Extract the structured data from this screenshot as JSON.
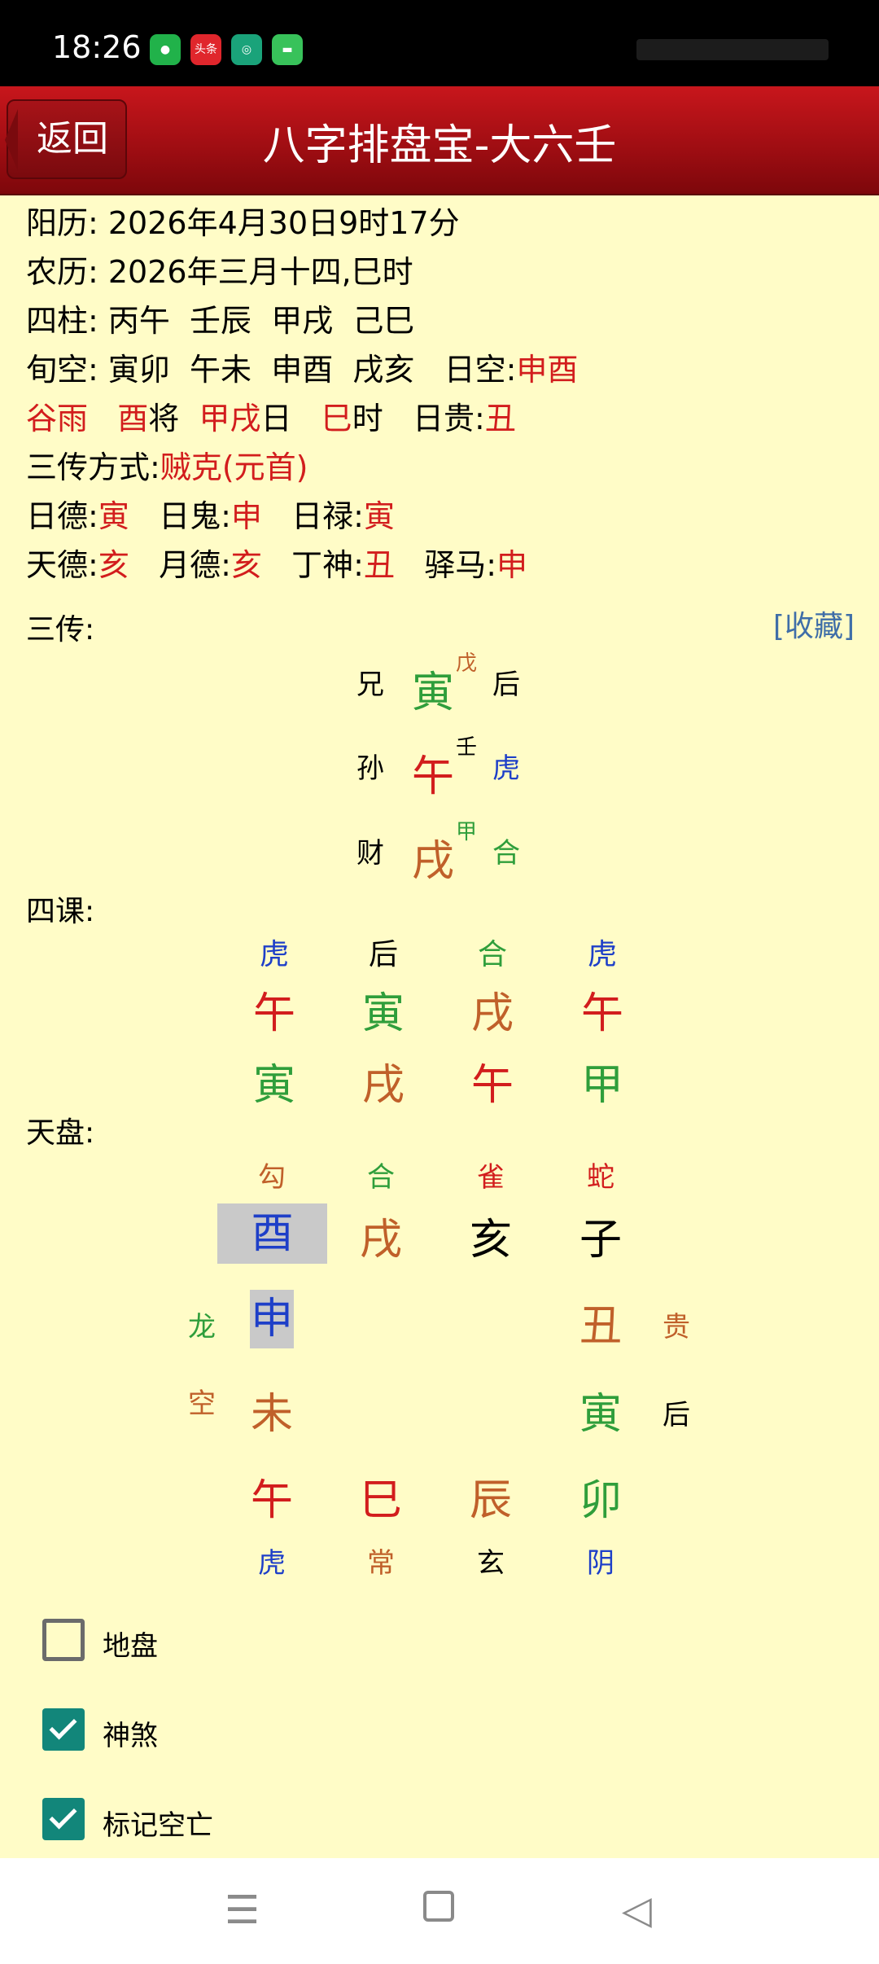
{
  "status": {
    "time": "18:26",
    "app2_label": "头条"
  },
  "header": {
    "back_label": "返回",
    "title": "八字排盘宝-大六壬"
  },
  "info": {
    "solar": "阳历: 2026年4月30日9时17分",
    "lunar": "农历: 2026年三月十四,巳时",
    "pillars": "四柱: 丙午  壬辰  甲戌  己巳",
    "xunkong_prefix": "旬空: 寅卯  午未  申酉  戌亥   日空:",
    "rikong": "申酉",
    "term": "谷雨",
    "jiang_branch": "酉",
    "jiang_label": "将",
    "day_gz": "甲戌",
    "day_label": "日",
    "hour_branch": "巳",
    "hour_label": "时",
    "rigui_label": "日贵:",
    "rigui": "丑",
    "method_label": "三传方式:",
    "method": "贼克(元首)",
    "ride_label": "日德:",
    "ride": "寅",
    "rigui2_label": "日鬼:",
    "rigui2": "申",
    "rilu_label": "日禄:",
    "rilu": "寅",
    "tiande_label": "天德:",
    "tiande": "亥",
    "yuede_label": "月德:",
    "yuede": "亥",
    "dingshen_label": "丁神:",
    "dingshen": "丑",
    "yima_label": "驿马:",
    "yima": "申"
  },
  "sanchuan": {
    "label": "三传:",
    "favorite": "[收藏]",
    "rows": [
      {
        "relation": "兄",
        "branch": "寅",
        "stem": "戊",
        "general": "后"
      },
      {
        "relation": "孙",
        "branch": "午",
        "stem": "壬",
        "general": "虎"
      },
      {
        "relation": "财",
        "branch": "戌",
        "stem": "甲",
        "general": "合"
      }
    ]
  },
  "sike": {
    "label": "四课:",
    "generals": [
      "虎",
      "后",
      "合",
      "虎"
    ],
    "upper": [
      "午",
      "寅",
      "戌",
      "午"
    ],
    "lower": [
      "寅",
      "戌",
      "午",
      "甲"
    ]
  },
  "tianpan": {
    "label": "天盘:",
    "top_generals": [
      "勾",
      "合",
      "雀",
      "蛇"
    ],
    "top_branches": [
      "酉",
      "戌",
      "亥",
      "子"
    ],
    "left_labels": [
      "龙",
      "空"
    ],
    "left_branches": [
      "申",
      "未"
    ],
    "right_branches": [
      "丑",
      "寅"
    ],
    "right_generals": [
      "贵",
      "后"
    ],
    "bottom_branches": [
      "午",
      "巳",
      "辰",
      "卯"
    ],
    "bottom_generals": [
      "虎",
      "常",
      "玄",
      "阴"
    ]
  },
  "options": [
    {
      "label": "地盘",
      "checked": false
    },
    {
      "label": "神煞",
      "checked": true
    },
    {
      "label": "标记空亡",
      "checked": true
    }
  ],
  "colors": {
    "background": "#fffcc7",
    "title_bar": "#b01218",
    "red": "#d21d1d",
    "orange": "#c0602a",
    "green": "#2f9e3b",
    "blue": "#1e3fc8",
    "checkbox": "#12867a",
    "favorite_link": "#3f6ea8"
  },
  "icons": {
    "nav": [
      "menu-icon",
      "home-icon",
      "back-triangle-icon"
    ]
  }
}
